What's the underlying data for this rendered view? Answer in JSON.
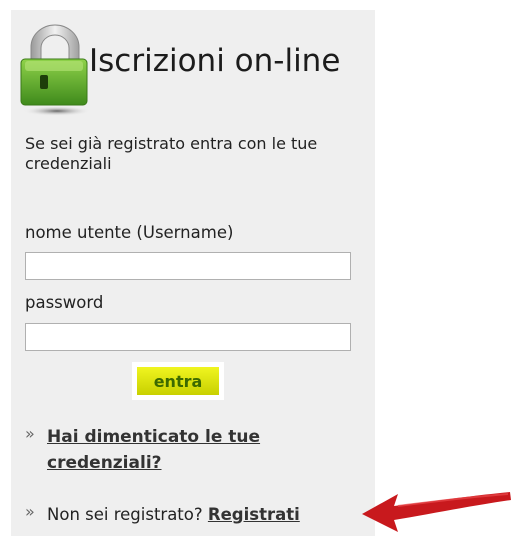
{
  "header": {
    "title": "Iscrizioni on-line"
  },
  "intro_text": "Se sei già registrato entra con le tue credenziali",
  "form": {
    "username_label": "nome utente (Username)",
    "username_value": "",
    "password_label": "password",
    "password_value": "",
    "submit_label": "entra"
  },
  "links": {
    "forgot_text": "Hai dimenticato le tue credenziali?",
    "not_registered_text": "Non sei registrato?",
    "register_text": "Registrati",
    "bullet": "»"
  },
  "colors": {
    "panel_bg": "#efefef",
    "button_yellow": "#e6ec10",
    "arrow_red": "#c8191d",
    "lock_green": "#5aa02c"
  },
  "icons": {
    "lock": "padlock-icon",
    "arrow": "red-arrow-icon"
  }
}
